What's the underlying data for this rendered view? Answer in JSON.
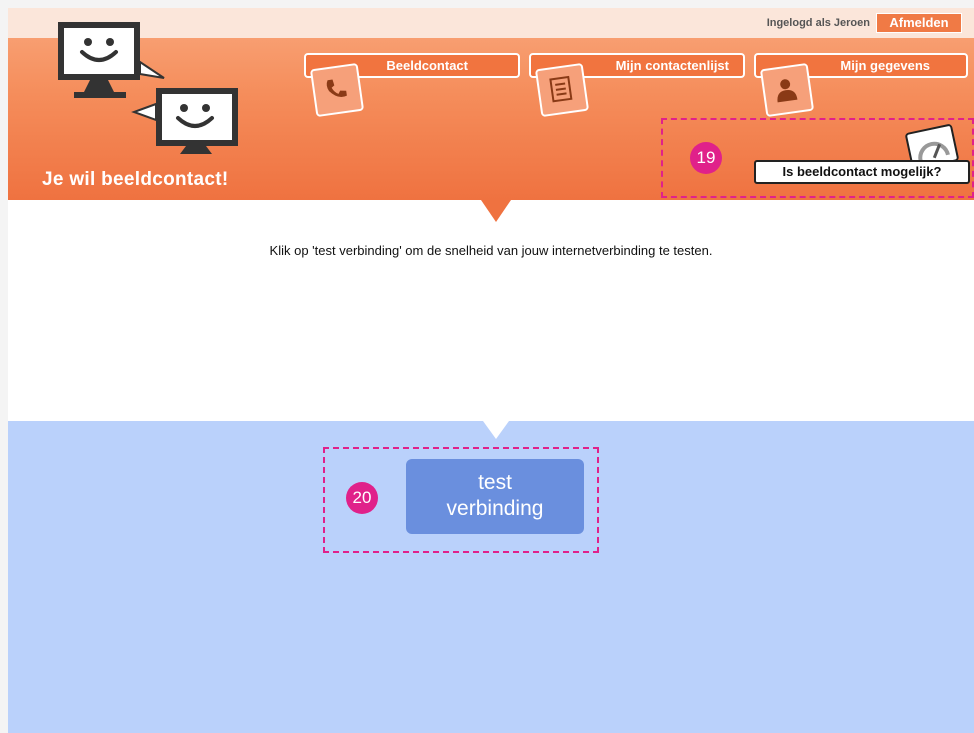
{
  "header": {
    "login_text": "Ingelogd als Jeroen",
    "logout_label": "Afmelden",
    "tagline": "Je wil beeldcontact!",
    "nav": [
      {
        "label": "Beeldcontact",
        "icon": "phone-icon"
      },
      {
        "label": "Mijn contactenlijst",
        "icon": "contact-list-icon"
      },
      {
        "label": "Mijn gegevens",
        "icon": "person-icon"
      }
    ],
    "connection_check_label": "Is beeldcontact mogelijk?"
  },
  "main": {
    "instruction": "Klik op 'test verbinding' om de snelheid van jouw internetverbinding te testen.",
    "test_button_line1": "test",
    "test_button_line2": "verbinding"
  },
  "callouts": {
    "c19": "19",
    "c20": "20"
  },
  "colors": {
    "header_orange": "#f1743f",
    "bottom_blue": "#bad1fb",
    "button_blue": "#6a8fde",
    "callout_magenta": "#e0218a"
  }
}
